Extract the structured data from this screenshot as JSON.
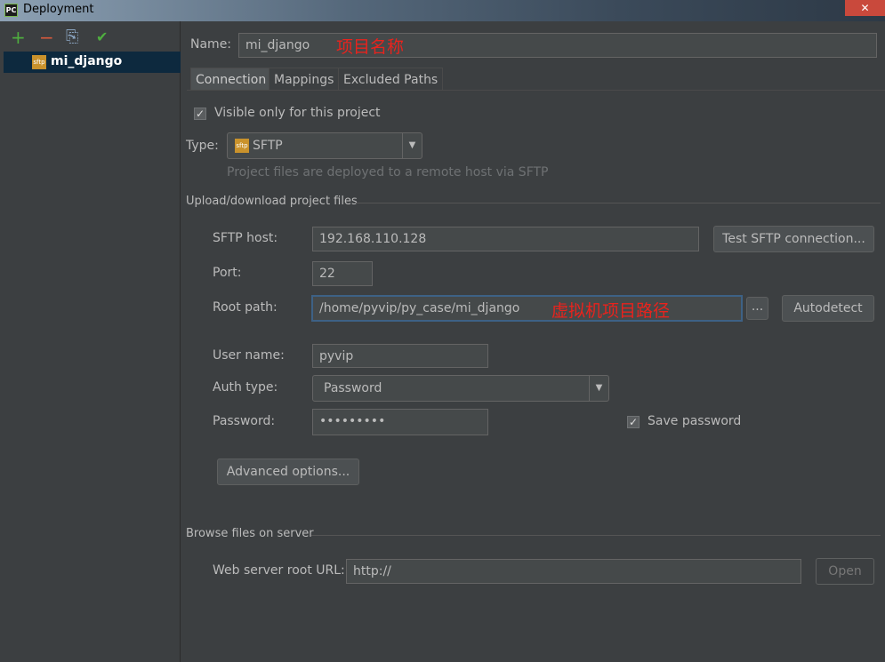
{
  "window": {
    "title": "Deployment",
    "close": "✕"
  },
  "sidebar": {
    "toolbar": {
      "add": "+",
      "remove": "−",
      "copy": "⎘",
      "default": "✔"
    },
    "servers": [
      {
        "label": "mi_django",
        "icon_text": "sftp"
      }
    ]
  },
  "form": {
    "name_label": "Name:",
    "name_value": "mi_django",
    "name_annotation": "项目名称",
    "tabs": [
      {
        "label": "Connection"
      },
      {
        "label": "Mappings"
      },
      {
        "label": "Excluded Paths"
      }
    ],
    "visible_only_label": "Visible only for this project",
    "visible_only_checked": true,
    "type_label": "Type:",
    "type_value": "SFTP",
    "type_icon_text": "sftp",
    "type_hint": "Project files are deployed to a remote host via SFTP",
    "upload_section": "Upload/download project files",
    "host_label": "SFTP host:",
    "host_value": "192.168.110.128",
    "test_button": "Test SFTP connection...",
    "port_label": "Port:",
    "port_value": "22",
    "root_label": "Root path:",
    "root_value": "/home/pyvip/py_case/mi_django",
    "root_annotation": "虚拟机项目路径",
    "browse_button": "...",
    "autodetect_button": "Autodetect",
    "user_label": "User name:",
    "user_value": "pyvip",
    "auth_label": "Auth type:",
    "auth_value": "Password",
    "password_label": "Password:",
    "password_value": "•••••••••",
    "save_password_label": "Save password",
    "save_password_checked": true,
    "advanced_button": "Advanced options...",
    "browse_section": "Browse files on server",
    "web_url_label": "Web server root URL:",
    "web_url_value": "http://",
    "open_button": "Open"
  }
}
